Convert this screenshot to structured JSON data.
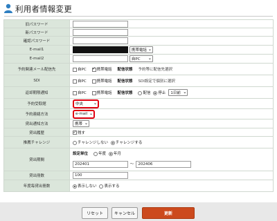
{
  "header": {
    "title": "利用者情報変更"
  },
  "labels": {
    "current_password": "旧パスワード",
    "new_password": "新パスワード",
    "confirm_password": "確認パスワード",
    "email1": "E-mail1",
    "email2": "E-mail2",
    "notify_dest": "予約関連メール配信先",
    "sdi": "SDI",
    "overdue": "返却期限通知",
    "reserve_location": "予約受取館",
    "reserve_contact": "予約連絡方法",
    "lending_contact": "貸出通知方法",
    "history": "貸出履歴",
    "recommend": "推薦チャレンジ",
    "period": "貸出期間",
    "count": "貸出冊数",
    "annual": "年度毎貸出冊数"
  },
  "email1": {
    "type_value": "携帯電話"
  },
  "email2": {
    "value": "",
    "type_value": "自PC"
  },
  "notify_dest": {
    "opt1": "自PC",
    "opt2": "携帯電話",
    "status_label": "配信状態",
    "status_text": "予約等に配信先選択"
  },
  "sdi": {
    "opt1": "自PC",
    "opt2": "携帯電話",
    "status_label": "配信状態",
    "status_text": "SDI設定で個別に選択"
  },
  "overdue": {
    "opt1": "自PC",
    "opt2": "携帯電話",
    "status_label": "配信状態",
    "radio1": "配信",
    "radio2": "停止",
    "days_value": "1日前"
  },
  "reserve_location": {
    "value": "中央"
  },
  "reserve_contact": {
    "value": "e-mail"
  },
  "lending_contact": {
    "value": "携帯"
  },
  "history": {
    "label": "残す"
  },
  "recommend": {
    "opt1": "チャレンジしない",
    "opt2": "チャレンジする"
  },
  "period": {
    "unit_label": "設定単位",
    "opt1": "年度",
    "opt2": "年月",
    "from": "202401",
    "sep": "～",
    "to": "202406"
  },
  "count": {
    "value": "100"
  },
  "annual": {
    "opt1": "表示しない",
    "opt2": "表示する"
  },
  "buttons": {
    "reset": "リセット",
    "cancel": "キャンセル",
    "update": "更新"
  }
}
